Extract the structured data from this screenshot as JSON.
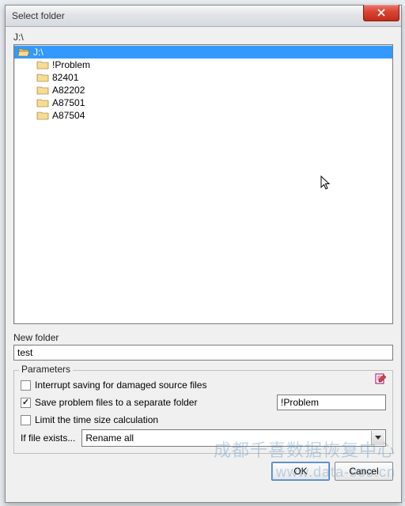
{
  "title": "Select folder",
  "current_path": "J:\\",
  "tree": {
    "root": "J:\\",
    "children": [
      "!Problem",
      "82401",
      "A82202",
      "A87501",
      "A87504"
    ]
  },
  "new_folder_label": "New folder",
  "new_folder_value": "test",
  "parameters": {
    "legend": "Parameters",
    "interrupt": {
      "checked": false,
      "label": "Interrupt saving for damaged source files"
    },
    "separate": {
      "checked": true,
      "label": "Save problem files to a separate folder",
      "value": "!Problem"
    },
    "limit": {
      "checked": false,
      "label": "Limit the time size calculation"
    },
    "if_exists_label": "If file exists...",
    "if_exists_value": "Rename all"
  },
  "buttons": {
    "ok": "OK",
    "cancel": "Cancel"
  },
  "watermark": {
    "line1": "成都千喜数据恢复中心",
    "line2": "www.data-sos.cn"
  }
}
